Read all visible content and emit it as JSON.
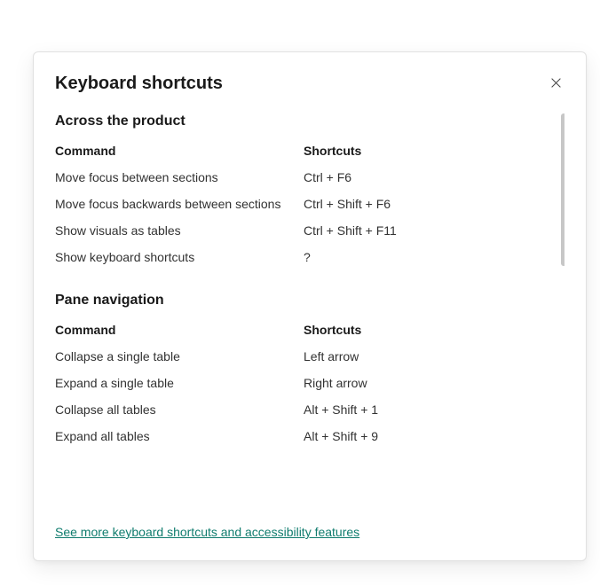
{
  "dialog": {
    "title": "Keyboard shortcuts",
    "footer_link": "See more keyboard shortcuts and accessibility features"
  },
  "headers": {
    "command": "Command",
    "shortcuts": "Shortcuts"
  },
  "sections": [
    {
      "title": "Across the product",
      "rows": [
        {
          "command": "Move focus between sections",
          "shortcut": "Ctrl + F6"
        },
        {
          "command": "Move focus backwards between sections",
          "shortcut": "Ctrl + Shift + F6"
        },
        {
          "command": "Show visuals as tables",
          "shortcut": "Ctrl + Shift + F11"
        },
        {
          "command": "Show keyboard shortcuts",
          "shortcut": "?"
        }
      ]
    },
    {
      "title": "Pane navigation",
      "rows": [
        {
          "command": "Collapse a single table",
          "shortcut": "Left arrow"
        },
        {
          "command": "Expand a single table",
          "shortcut": "Right arrow"
        },
        {
          "command": "Collapse all tables",
          "shortcut": "Alt + Shift + 1"
        },
        {
          "command": "Expand all tables",
          "shortcut": "Alt + Shift + 9"
        }
      ]
    }
  ]
}
